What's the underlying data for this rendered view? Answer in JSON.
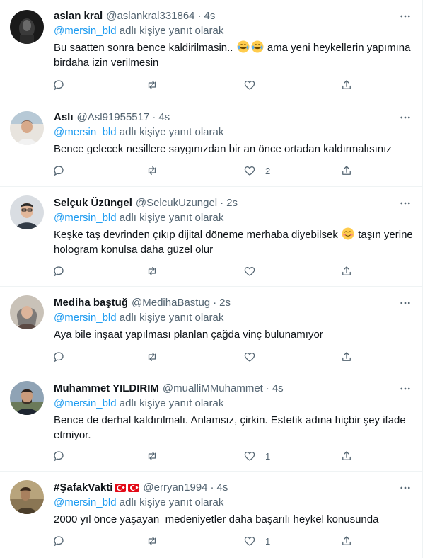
{
  "reply_prefix_label": "adlı kişiye yanıt olarak",
  "accent_color": "#1d9bf0",
  "tweets": [
    {
      "name": "aslan kral",
      "handle": "@aslankral331864",
      "dot": "·",
      "time": "4s",
      "reply_to": "@mersin_bld",
      "reply_suffix": "adlı kişiye yanıt olarak",
      "text_a": "Bu saatten sonra bence kaldirilmasin..",
      "emojis": [
        "joy-emoji",
        "joy-emoji"
      ],
      "text_b": "ama yeni heykellerin yapımına birdaha izin verilmesin",
      "like_count": ""
    },
    {
      "name": "Aslı",
      "handle": "@Asl91955517",
      "dot": "·",
      "time": "4s",
      "reply_to": "@mersin_bld",
      "reply_suffix": "adlı kişiye yanıt olarak",
      "text": "Bence gelecek nesillere saygınızdan bir an önce ortadan kaldırmalısınız",
      "like_count": "2"
    },
    {
      "name": "Selçuk Üzüngel",
      "handle": "@SelcukUzungel",
      "dot": "·",
      "time": "2s",
      "reply_to": "@mersin_bld",
      "reply_suffix": "adlı kişiye yanıt olarak",
      "text_a": "Keşke taş devrinden çıkıp dijital döneme merhaba diyebilsek",
      "emojis": [
        "smiling-face-emoji"
      ],
      "text_b": "taşın yerine hologram konulsa daha güzel olur",
      "like_count": ""
    },
    {
      "name": "Mediha baştuğ",
      "handle": "@MedihaBastug",
      "dot": "·",
      "time": "2s",
      "reply_to": "@mersin_bld",
      "reply_suffix": "adlı kişiye yanıt olarak",
      "text": "Aya bile inşaat yapılması planlan çağda vinç bulunamıyor",
      "like_count": ""
    },
    {
      "name": "Muhammet YILDIRIM",
      "handle": "@mualliMMuhammet",
      "dot": "·",
      "time": "4s",
      "reply_to": "@mersin_bld",
      "reply_suffix": "adlı kişiye yanıt olarak",
      "text": "Bence de derhal kaldırılmalı. Anlamsız, çirkin. Estetik adına hiçbir şey ifade etmiyor.",
      "like_count": "1"
    },
    {
      "name": "#ŞafakVakti",
      "name_flags": [
        "turkey-flag-icon",
        "turkey-flag-icon"
      ],
      "handle": "@erryan1994",
      "dot": "·",
      "time": "4s",
      "reply_to": "@mersin_bld",
      "reply_suffix": "adlı kişiye yanıt olarak",
      "text": "2000 yıl önce yaşayan  medeniyetler daha başarılı heykel konusunda",
      "like_count": "1"
    }
  ],
  "icons": {
    "more": "more-horizontal-icon",
    "reply": "reply-bubble-icon",
    "retweet": "retweet-icon",
    "like": "heart-icon",
    "share": "share-icon"
  }
}
